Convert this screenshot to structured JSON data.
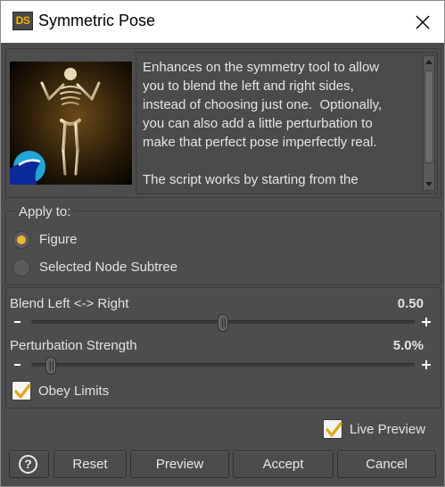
{
  "window": {
    "app_icon": "DS",
    "title": "Symmetric Pose",
    "close_icon": "close-icon"
  },
  "info": {
    "description": "Enhances on the symmetry tool to allow\nyou to blend the left and right sides,\ninstead of choosing just one.  Optionally,\nyou can also add a little perturbation to\nmake that perfect pose imperfectly real.\n\nThe script works by starting from the"
  },
  "apply_to": {
    "title": "Apply to:",
    "options": [
      {
        "label": "Figure",
        "selected": true
      },
      {
        "label": "Selected Node Subtree",
        "selected": false
      }
    ]
  },
  "blend": {
    "label": "Blend Left <-> Right",
    "value_text": "0.50",
    "value": 0.5
  },
  "perturbation": {
    "label": "Perturbation Strength",
    "value_text": "5.0%",
    "value": 0.05
  },
  "obey_limits": {
    "label": "Obey Limits",
    "checked": true
  },
  "live_preview": {
    "label": "Live Preview",
    "checked": true
  },
  "buttons": {
    "help": "?",
    "reset": "Reset",
    "preview": "Preview",
    "accept": "Accept",
    "cancel": "Cancel"
  },
  "colors": {
    "accent": "#f2b632",
    "background": "#4d4d4d"
  }
}
